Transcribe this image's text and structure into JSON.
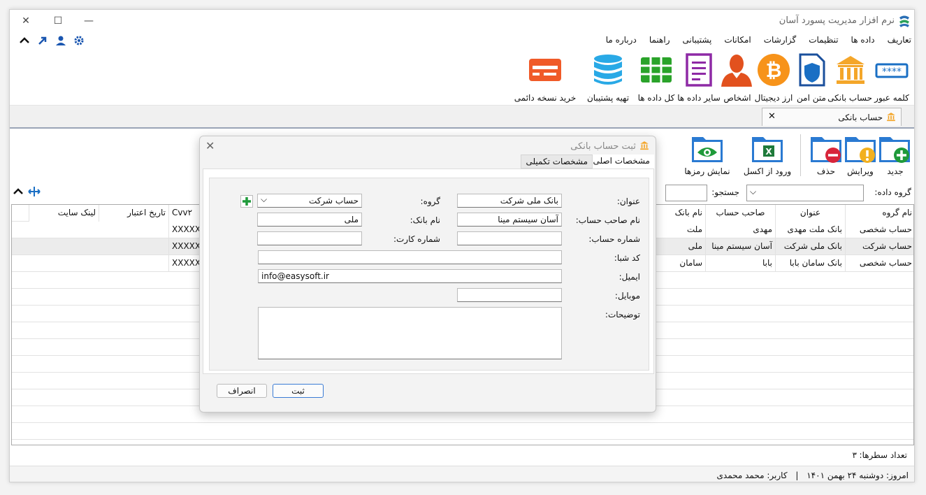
{
  "window": {
    "title": "نرم افزار مدیریت پسورد آسان"
  },
  "menu": [
    "تعاریف",
    "داده ها",
    "تنظیمات",
    "گزارشات",
    "امکانات",
    "پشتیبانی",
    "راهنما",
    "درباره ما"
  ],
  "ribbon": [
    {
      "label": "کلمه عبور",
      "icon": "password-icon"
    },
    {
      "label": "حساب بانکی",
      "icon": "bank-icon"
    },
    {
      "label": "متن امن",
      "icon": "secure-document-icon"
    },
    {
      "label": "ارز دیجیتال",
      "icon": "bitcoin-icon"
    },
    {
      "label": "اشخاص",
      "icon": "person-icon"
    },
    {
      "label": "سایر داده ها",
      "icon": "notes-icon"
    },
    {
      "label": "کل داده ها",
      "icon": "table-icon"
    },
    {
      "label": "تهیه پشتیبان",
      "icon": "database-icon"
    },
    {
      "label": "خرید نسخه دائمی",
      "icon": "credit-card-icon"
    }
  ],
  "tab": {
    "label": "حساب بانکی",
    "close": "x"
  },
  "toolbar": {
    "new": "جدید",
    "edit": "ویرایش",
    "delete": "حذف",
    "excel": "ورود از اکسل",
    "show_passwords": "نمایش رمزها"
  },
  "filter": {
    "group_label": "گروه داده:",
    "search_label": "جستجو:"
  },
  "grid": {
    "columns": [
      "نام گروه",
      "عنوان",
      "صاحب حساب",
      "نام بانک",
      "Cvv۲",
      "تاریخ اعتبار",
      "لینک سایت"
    ],
    "rows": [
      [
        "حساب شخصی",
        "بانک ملت مهدی",
        "مهدی",
        "ملت",
        "XXXXX",
        "",
        ""
      ],
      [
        "حساب شرکت",
        "بانک ملی شرکت",
        "آسان سیستم مینا",
        "ملی",
        "XXXXX",
        "",
        ""
      ],
      [
        "حساب شخصی",
        "بانک سامان بابا",
        "بابا",
        "سامان",
        "XXXXX",
        "",
        ""
      ]
    ]
  },
  "row_count": {
    "label": "تعداد سطرها:",
    "value": "۳"
  },
  "status": {
    "date": "امروز: دوشنبه ۲۴ بهمن ۱۴۰۱",
    "sep": "|",
    "user": "کاربر: محمد محمدی"
  },
  "dialog": {
    "title": "ثبت حساب بانکی",
    "tabs": [
      "مشخصات اصلی",
      "مشخصات تکمیلی"
    ],
    "fields": {
      "title_label": "عنوان:",
      "title_value": "بانک ملی شرکت",
      "group_label": "گروه:",
      "group_value": "حساب شرکت",
      "owner_label": "نام صاحب حساب:",
      "owner_value": "آسان سیستم مینا",
      "bank_label": "نام بانک:",
      "bank_value": "ملی",
      "account_label": "شماره حساب:",
      "account_value": "",
      "card_label": "شماره کارت:",
      "card_value": "",
      "sheba_label": "کد شبا:",
      "sheba_value": "",
      "email_label": "ایمیل:",
      "email_value": "info@easysoft.ir",
      "mobile_label": "موبایل:",
      "mobile_value": "",
      "notes_label": "توضیحات:",
      "notes_value": ""
    },
    "save": "ثبت",
    "cancel": "انصراف"
  },
  "colors": {
    "accent": "#1a6fc4",
    "folder": "#2a7ad2"
  }
}
